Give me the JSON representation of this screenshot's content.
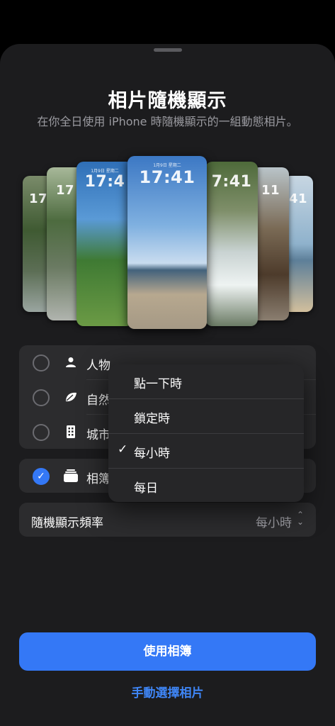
{
  "sheet": {
    "title": "相片隨機顯示",
    "subtitle": "在你全日使用 iPhone 時隨機顯示的一組動態相片。"
  },
  "carousel": {
    "cards": [
      {
        "date": "",
        "time": "17"
      },
      {
        "date": "",
        "time": "17"
      },
      {
        "date": "1月9日 星期二",
        "time": "17:4"
      },
      {
        "date": "1月9日 星期二",
        "time": "17:41"
      },
      {
        "date": "",
        "time": "7:41"
      },
      {
        "date": "",
        "time": "11"
      },
      {
        "date": "",
        "time": "41"
      }
    ]
  },
  "categories": [
    {
      "label": "人物",
      "icon": "person-icon"
    },
    {
      "label": "自然",
      "icon": "leaf-icon"
    },
    {
      "label": "城市",
      "icon": "building-icon"
    }
  ],
  "album": {
    "label": "相簿",
    "icon": "album-stack-icon",
    "selected": true
  },
  "frequency": {
    "label": "隨機顯示頻率",
    "value": "每小時"
  },
  "menu": {
    "items": [
      {
        "label": "點一下時",
        "checked": false
      },
      {
        "label": "鎖定時",
        "checked": false
      },
      {
        "label": "每小時",
        "checked": true
      },
      {
        "label": "每日",
        "checked": false
      }
    ],
    "check_glyph": "✓"
  },
  "buttons": {
    "primary": "使用相簿",
    "secondary": "手動選擇相片"
  },
  "colors": {
    "accent": "#3478f6",
    "background": "#1c1c1e",
    "cell": "#2c2c2e"
  }
}
